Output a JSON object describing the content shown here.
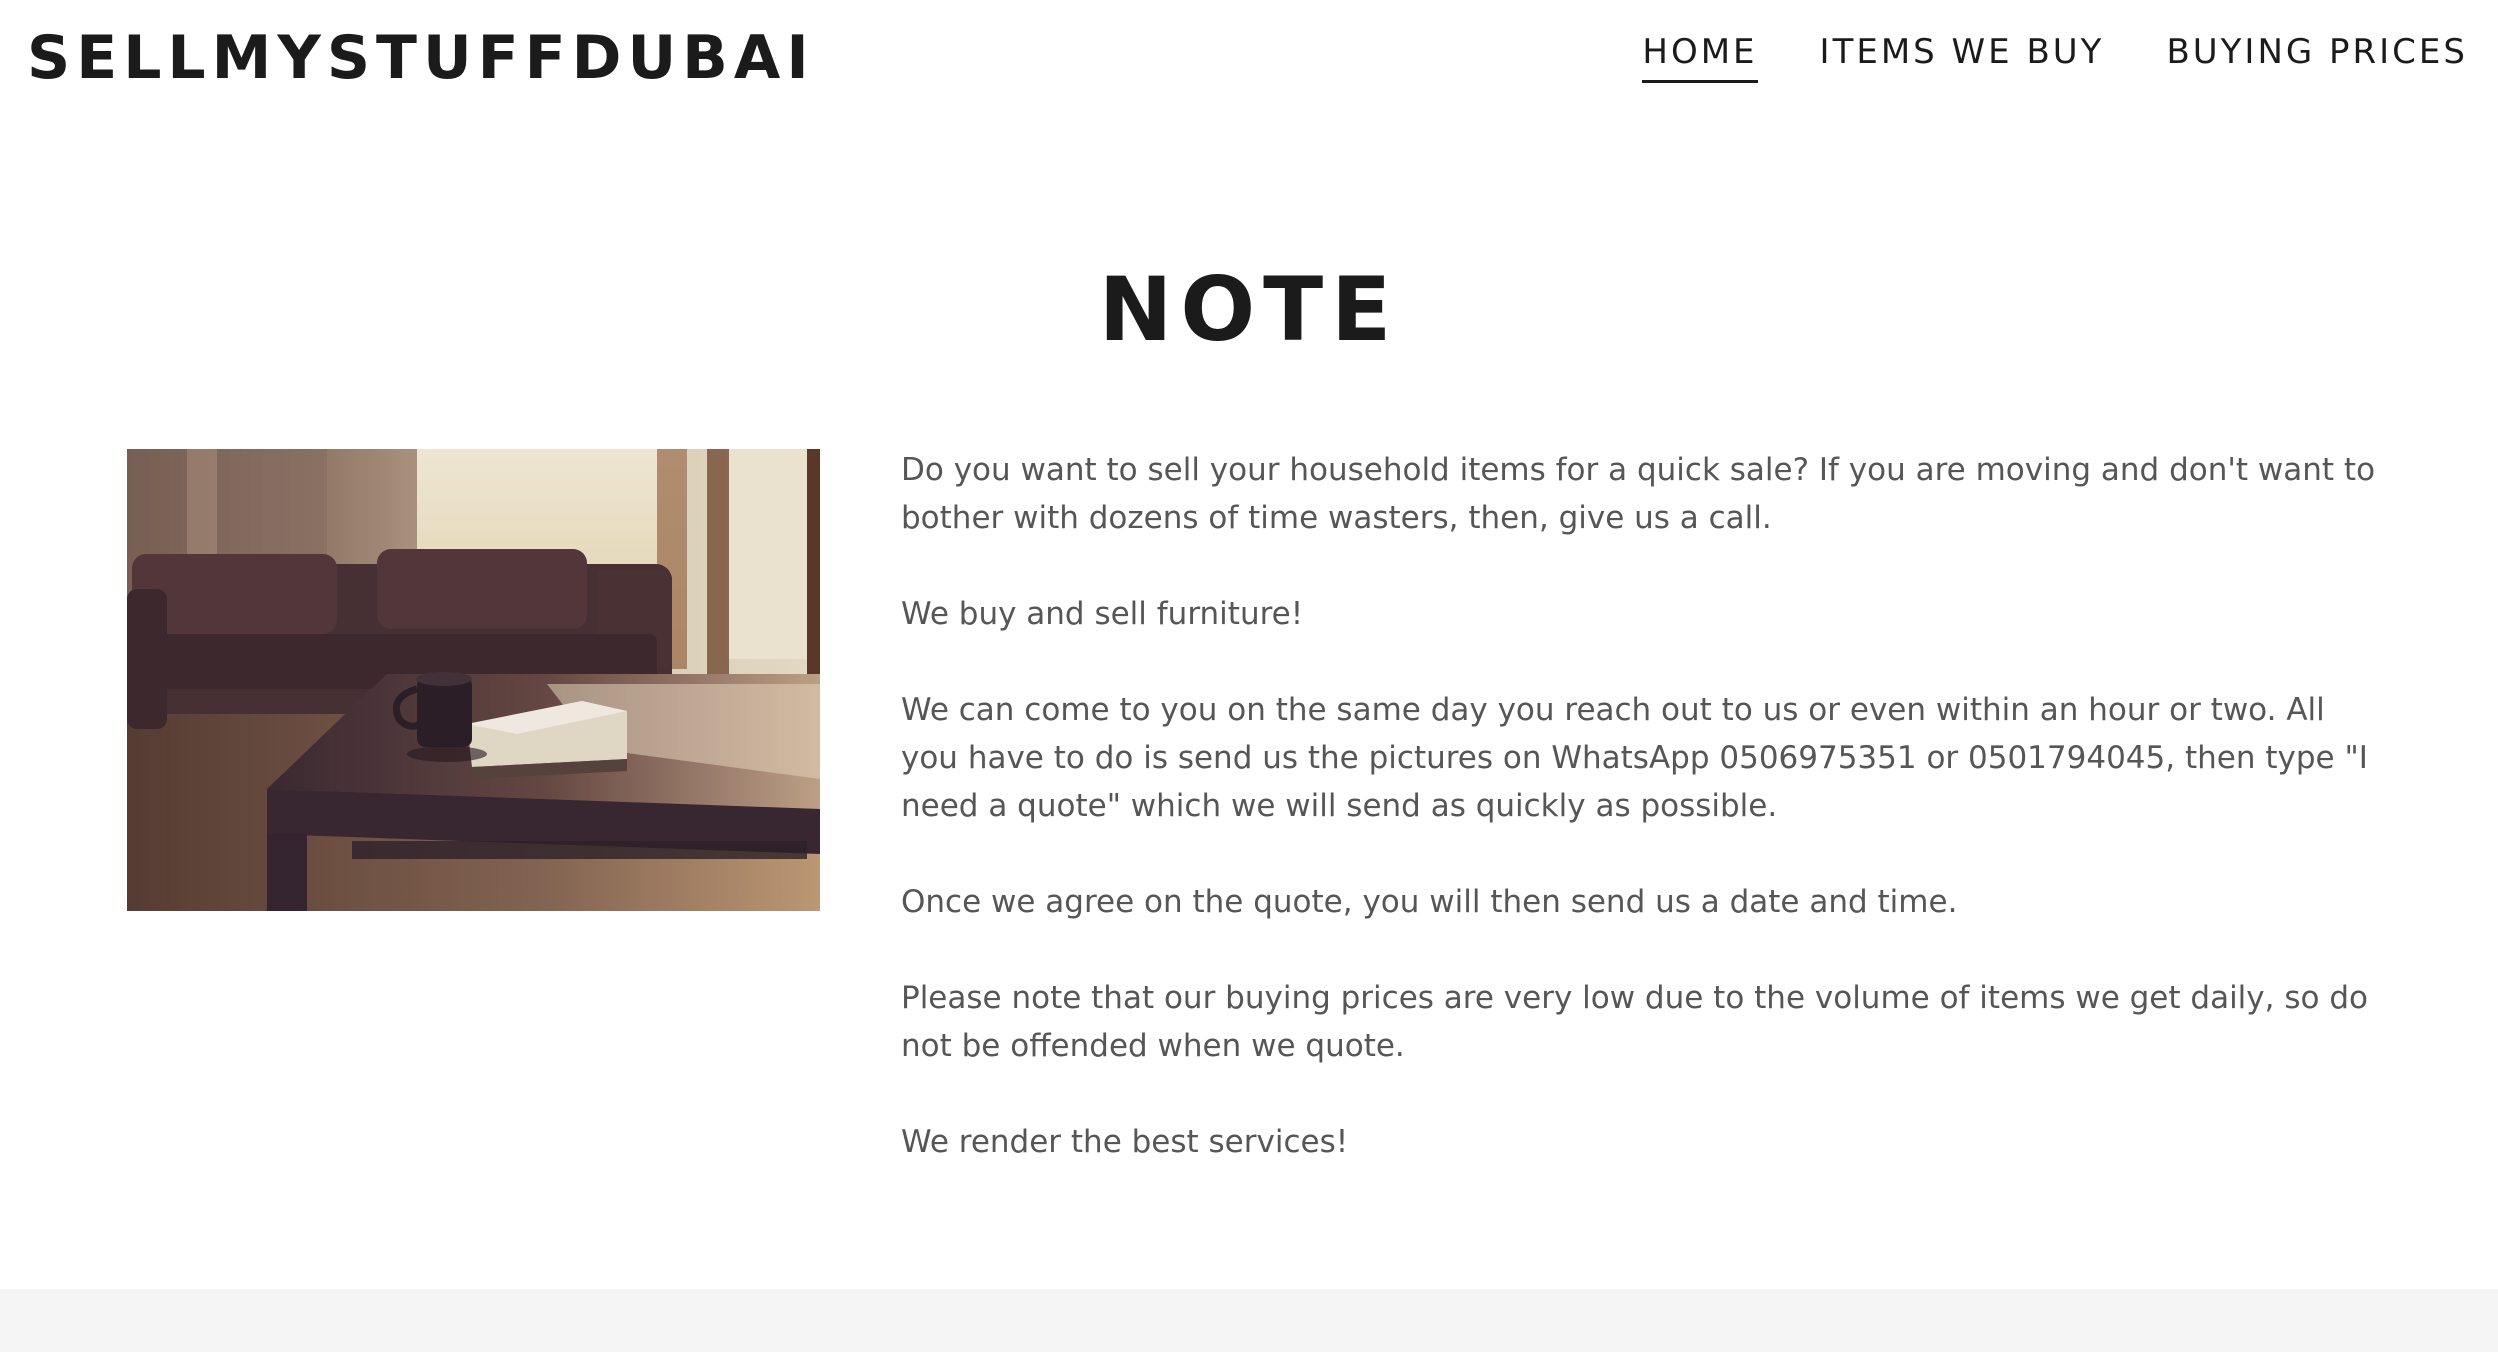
{
  "header": {
    "logo": "SELLMYSTUFFDUBAI",
    "nav": [
      {
        "label": "HOME",
        "active": true
      },
      {
        "label": "ITEMS WE BUY",
        "active": false
      },
      {
        "label": "BUYING PRICES",
        "active": false
      }
    ]
  },
  "section": {
    "title": "NOTE",
    "paragraphs": [
      "Do you want to sell your household items for a quick sale? If you are moving and don't want to bother with dozens of time wasters, then, give us a call.",
      "We buy and sell furniture!",
      "We can come to you on the same day you reach out to us or even within an hour or two. All you have to do is send us the pictures on WhatsApp 0506975351 or 0501794045, then type \"I need a quote\" which we will send as quickly as possible.",
      "Once we agree on the quote, you will then send us a date and time.",
      "Please note that our buying prices are very low due to the volume of items we get daily, so do not be offended when we quote.",
      "We render the best services!"
    ]
  },
  "colors": {
    "text_dark": "#1b1b1b",
    "text_body": "#565656",
    "footer_bg": "#f5f5f5"
  }
}
